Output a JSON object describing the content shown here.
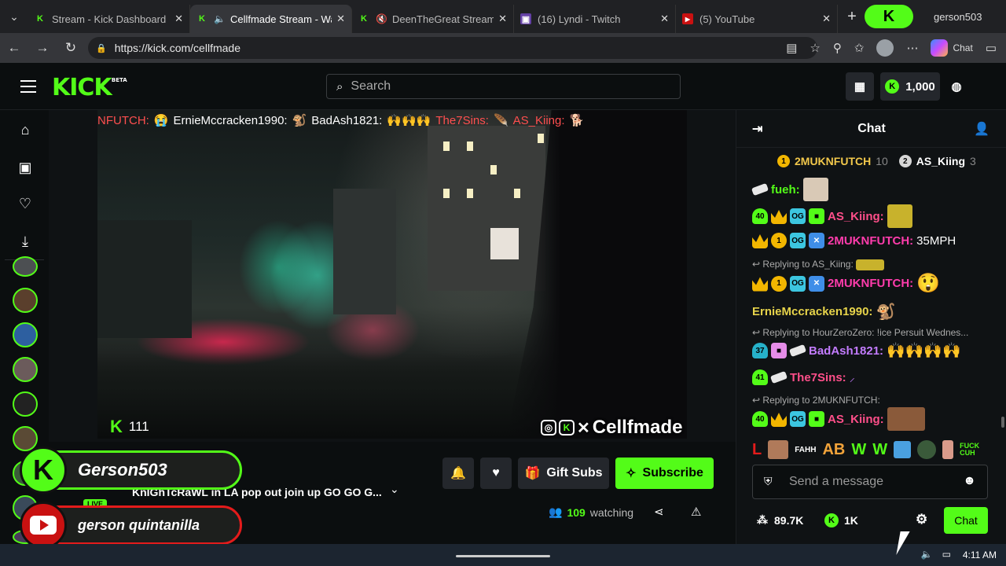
{
  "browser": {
    "tabs": [
      {
        "title": "Stream - Kick Dashboard",
        "favicon": "kick-icon",
        "active": false,
        "muted": false
      },
      {
        "title": "Cellfmade Stream - Wa",
        "favicon": "kick-icon",
        "active": true,
        "muted": false,
        "audio": true
      },
      {
        "title": "DeenTheGreat Stream",
        "favicon": "kick-icon",
        "active": false,
        "muted": true
      },
      {
        "title": "(16) Lyndi - Twitch",
        "favicon": "twitch-icon",
        "active": false,
        "muted": false
      },
      {
        "title": "(5) YouTube",
        "favicon": "youtube-icon",
        "active": false,
        "muted": false
      }
    ],
    "profile_name": "gerson503",
    "url": "https://kick.com/cellfmade",
    "copilot_label": "Chat"
  },
  "kick": {
    "logo": "KICK",
    "logo_beta": "BETA",
    "search_placeholder": "Search",
    "balance": "1,000"
  },
  "video": {
    "ticker": [
      {
        "name": "NFUTCH:",
        "text": "😭"
      },
      {
        "name": "ErnieMccracken1990:",
        "text": "🐒"
      },
      {
        "name": "BadAsh1821:",
        "text": "🙌🙌🙌"
      },
      {
        "name": "The7Sins:",
        "text": "🪶"
      },
      {
        "name": "AS_Kiing:",
        "text": "🐕"
      }
    ],
    "viewer_count": "111",
    "watermark": "Cellfmade"
  },
  "overlays": {
    "kick_name": "Gerson503",
    "youtube_name": "gerson quintanilla",
    "live_label": "LIVE"
  },
  "stream": {
    "title": "KnIGhTcRaWL in LA pop out join up GO GO G...",
    "gift_subs_label": "Gift Subs",
    "subscribe_label": "Subscribe",
    "watching_count": "109",
    "watching_label": "watching"
  },
  "chat": {
    "header": "Chat",
    "leaderboard": [
      {
        "rank": "1",
        "name": "2MUKNFUTCH",
        "count": "10"
      },
      {
        "rank": "2",
        "name": "AS_Kiing",
        "count": "3"
      }
    ],
    "messages": [
      {
        "user": "fueh:",
        "text": "",
        "color": "#53fc18"
      },
      {
        "user": "AS_Kiing:",
        "text": "",
        "color": "#ff4f8a",
        "badge": "40"
      },
      {
        "user": "2MUKNFUTCH:",
        "text": "35MPH",
        "color": "#ff3cac",
        "badge": "1"
      },
      {
        "reply_to": "Replying to AS_Kiing:"
      },
      {
        "user": "2MUKNFUTCH:",
        "text": "",
        "color": "#ff3cac",
        "badge": "1"
      },
      {
        "user": "ErnieMccracken1990:",
        "text": "",
        "color": "#e6d34a"
      },
      {
        "reply_to": "Replying to HourZeroZero: !ice Persuit Wednes..."
      },
      {
        "user": "BadAsh1821:",
        "text": "",
        "color": "#c37cff",
        "badge": "37"
      },
      {
        "user": "The7Sins:",
        "text": "",
        "color": "#ff4f8a",
        "badge": "41"
      },
      {
        "reply_to": "Replying to 2MUKNFUTCH:"
      },
      {
        "user": "AS_Kiing:",
        "text": "",
        "color": "#ff4f8a",
        "badge": "40"
      }
    ],
    "emote_row": [
      "L",
      "FAHH",
      "AB",
      "W",
      "W",
      "FUCK CUH"
    ],
    "input_placeholder": "Send a message",
    "followers": "89.7K",
    "kicks": "1K",
    "chat_button": "Chat"
  },
  "taskbar": {
    "time": "4:11 AM"
  },
  "colors": {
    "kick_green": "#53fc18",
    "background": "#0b0e0f",
    "youtube_red": "#e41b1b"
  }
}
